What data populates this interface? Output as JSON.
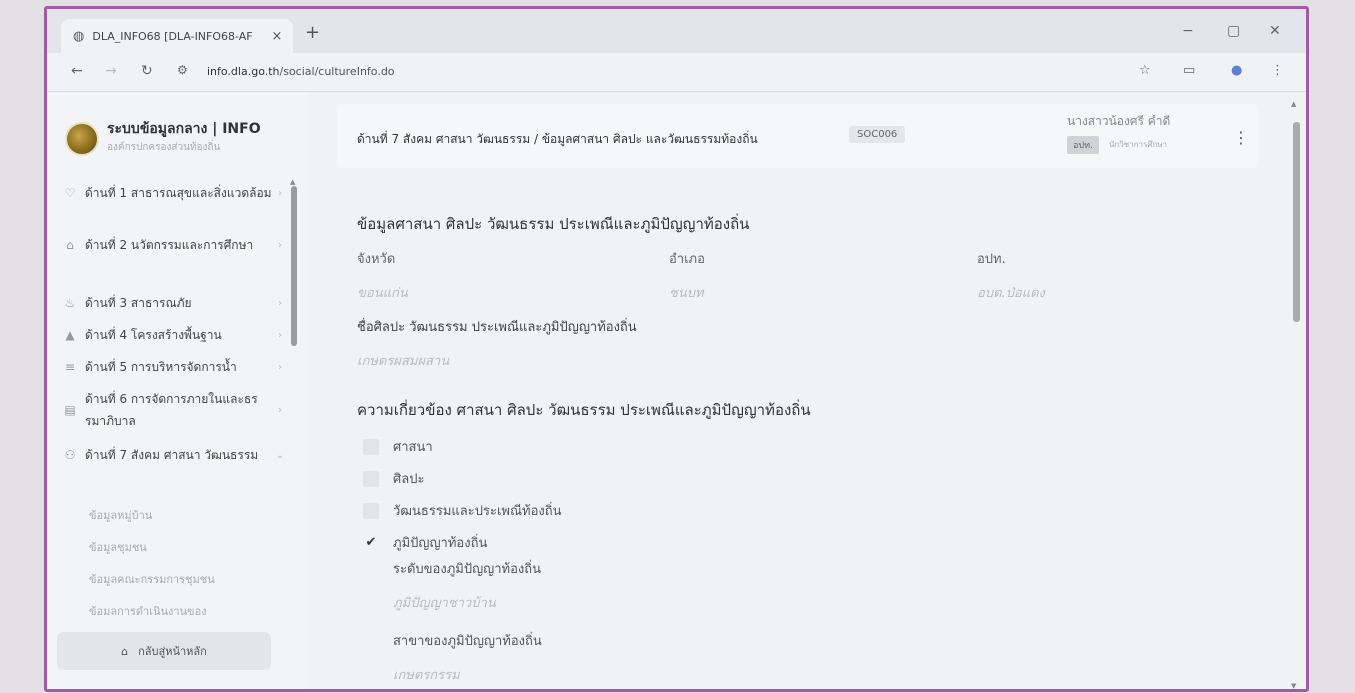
{
  "browser": {
    "tab_title": "DLA_INFO68 [DLA-INFO68-AF",
    "tab_close": "×",
    "new_tab": "+",
    "url_host": "info.dla.go.th",
    "url_path": "/social/cultureInfo.do",
    "controls": {
      "minimize": "−",
      "restore": "▢",
      "close": "✕"
    }
  },
  "sidebar": {
    "title": "ระบบข้อมูลกลาง | INFO",
    "subtitle": "องค์กรปกครองส่วนท้องถิ่น",
    "items": [
      {
        "label": "ด้านที่ 1 สาธารณสุขและสิ่งแวดล้อม",
        "icon": "heart-icon"
      },
      {
        "label": "ด้านที่ 2 นวัตกรรมและการศึกษา",
        "icon": "school-icon"
      },
      {
        "label": "ด้านที่ 3 สาธารณภัย",
        "icon": "fire-icon"
      },
      {
        "label": "ด้านที่ 4 โครงสร้างพื้นฐาน",
        "icon": "building-icon"
      },
      {
        "label": "ด้านที่ 5 การบริหารจัดการน้ำ",
        "icon": "water-icon"
      },
      {
        "label": "ด้านที่ 6 การจัดการภายในและธรรมาภิบาล",
        "icon": "document-icon"
      },
      {
        "label": "ด้านที่ 7 สังคม ศาสนา วัฒนธรรม",
        "icon": "people-icon"
      }
    ],
    "subitems": [
      "ข้อมูลหมู่บ้าน",
      "ข้อมูลชุมชน",
      "ข้อมูลคณะกรรมการชุมชน",
      "ข้อมลการดำเนินงานของ"
    ],
    "home_label": "กลับสู่หน้าหลัก"
  },
  "header": {
    "breadcrumb": "ด้านที่ 7 สังคม ศาสนา วัฒนธรรม /  ข้อมูลศาสนา ศิลปะ และวัฒนธรรมท้องถิ่น",
    "code": "SOC006",
    "user_name": "นางสาวน้องศรี คำดี",
    "user_tag": "อปท.",
    "user_role": "นักวิชาการศึกษา"
  },
  "section1": {
    "heading": "ข้อมูลศาสนา ศิลปะ วัฒนธรรม ประเพณีและภูมิปัญญาท้องถิ่น",
    "province_label": "จังหวัด",
    "province_value": "ขอนแก่น",
    "district_label": "อำเภอ",
    "district_value": "ชนบท",
    "lao_label": "อปท.",
    "lao_value": "อบต.ป่อแดง",
    "name_label": "ชื่อศิลปะ วัฒนธรรม ประเพณีและภูมิปัญญาท้องถิ่น",
    "name_value": "เกษตรผสมผสาน"
  },
  "section2": {
    "heading": "ความเกี่ยวข้อง ศาสนา ศิลปะ วัฒนธรรม ประเพณีและภูมิปัญญาท้องถิ่น",
    "checks": [
      {
        "label": "ศาสนา",
        "checked": false
      },
      {
        "label": "ศิลปะ",
        "checked": false
      },
      {
        "label": "วัฒนธรรมและประเพณีท้องถิ่น",
        "checked": false
      },
      {
        "label": "ภูมิปัญญาท้องถิ่น",
        "checked": true
      }
    ],
    "check_mark": "✔",
    "level_label": "ระดับของภูมิปัญญาท้องถิ่น",
    "level_value": "ภูมิปัญญาชาวบ้าน",
    "branch_label": "สาขาของภูมิปัญญาท้องถิ่น",
    "branch_value": "เกษตรกรรม"
  }
}
